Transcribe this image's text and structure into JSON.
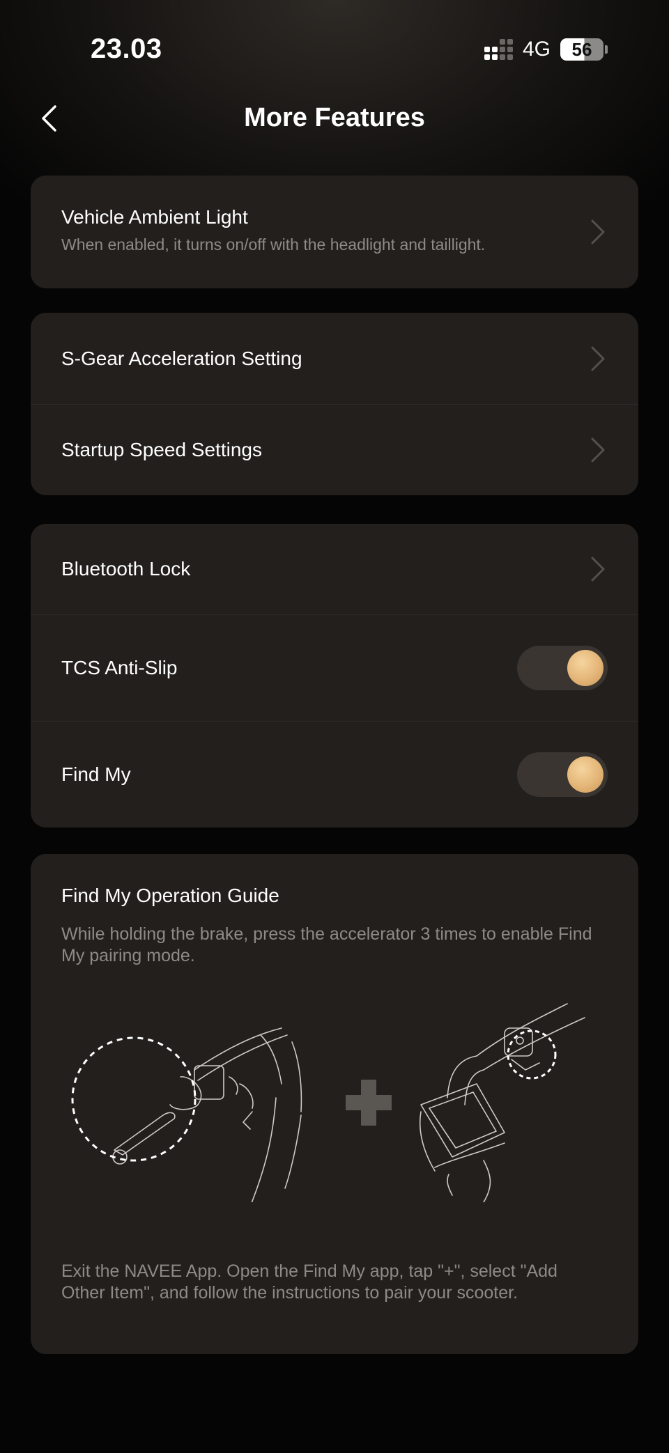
{
  "status_bar": {
    "time": "23.03",
    "network": "4G",
    "battery": "56",
    "battery_level_percent": 56
  },
  "header": {
    "back_icon": "chevron-left-icon",
    "title": "More Features"
  },
  "ambient_card": {
    "title": "Vehicle Ambient Light",
    "subtitle": "When enabled, it turns on/off with the headlight and taillight."
  },
  "speed_card": {
    "items": [
      {
        "label": "S-Gear Acceleration Setting"
      },
      {
        "label": "Startup Speed Settings"
      }
    ]
  },
  "security_card": {
    "bluetooth_lock": "Bluetooth Lock",
    "tcs": {
      "label": "TCS Anti-Slip",
      "enabled": true
    },
    "find_my": {
      "label": "Find My",
      "enabled": true
    }
  },
  "guide_card": {
    "title": "Find My Operation Guide",
    "step1": "While holding the brake, press the accelerator 3 times to enable Find My pairing mode.",
    "step2": "Exit the NAVEE App. Open the Find My app, tap \"+\", select \"Add Other Item\", and follow the instructions to pair your scooter."
  },
  "colors": {
    "background": "#050505",
    "card": "#221f1d",
    "accent": "#e2b274",
    "secondary_text": "#8f8a86",
    "toggle_track": "#3a3531"
  }
}
